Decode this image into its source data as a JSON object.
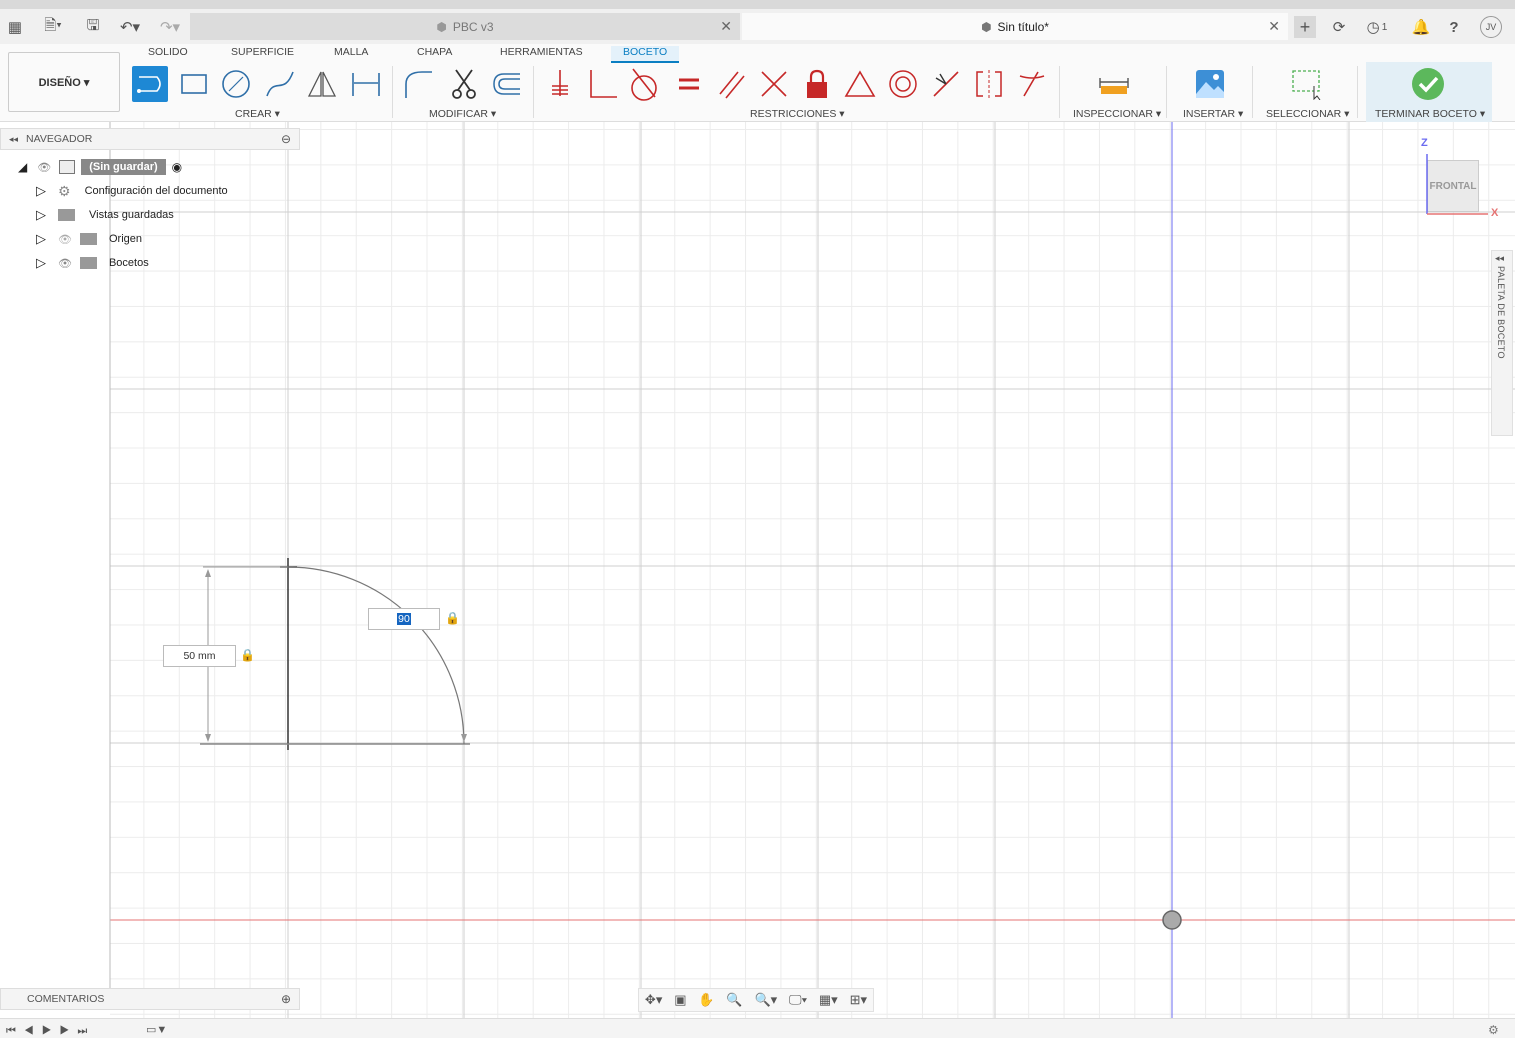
{
  "tabs": [
    {
      "label": "PBC v3",
      "active": false
    },
    {
      "label": "Sin título*",
      "active": true
    }
  ],
  "topbar": {
    "jobs_count": "1",
    "user_initials": "JV"
  },
  "ribbon": {
    "tabs": [
      "SOLIDO",
      "SUPERFICIE",
      "MALLA",
      "CHAPA",
      "HERRAMIENTAS",
      "BOCETO"
    ],
    "active_tab": "BOCETO",
    "workspace": "DISEÑO ▾",
    "groups": {
      "crear": "CREAR ▾",
      "modificar": "MODIFICAR ▾",
      "restricciones": "RESTRICCIONES ▾",
      "inspeccionar": "INSPECCIONAR ▾",
      "insertar": "INSERTAR ▾",
      "seleccionar": "SELECCIONAR ▾",
      "terminar": "TERMINAR BOCETO ▾"
    }
  },
  "navigator": {
    "title": "NAVEGADOR",
    "root": "(Sin guardar)",
    "items": [
      "Configuración del documento",
      "Vistas guardadas",
      "Origen",
      "Bocetos"
    ]
  },
  "comments": {
    "title": "COMENTARIOS"
  },
  "viewcube": {
    "face": "FRONTAL",
    "axis_z": "Z",
    "axis_x": "X"
  },
  "palette": {
    "label": "PALETA DE BOCETO"
  },
  "sketch": {
    "height_dim": "50 mm",
    "angle_dim": "90"
  },
  "colors": {
    "accent": "#0a7ec2",
    "constraint_red": "#c62828",
    "finish_green": "#5cb85c",
    "x_axis": "#e57373",
    "z_axis": "#6b6bf0"
  }
}
